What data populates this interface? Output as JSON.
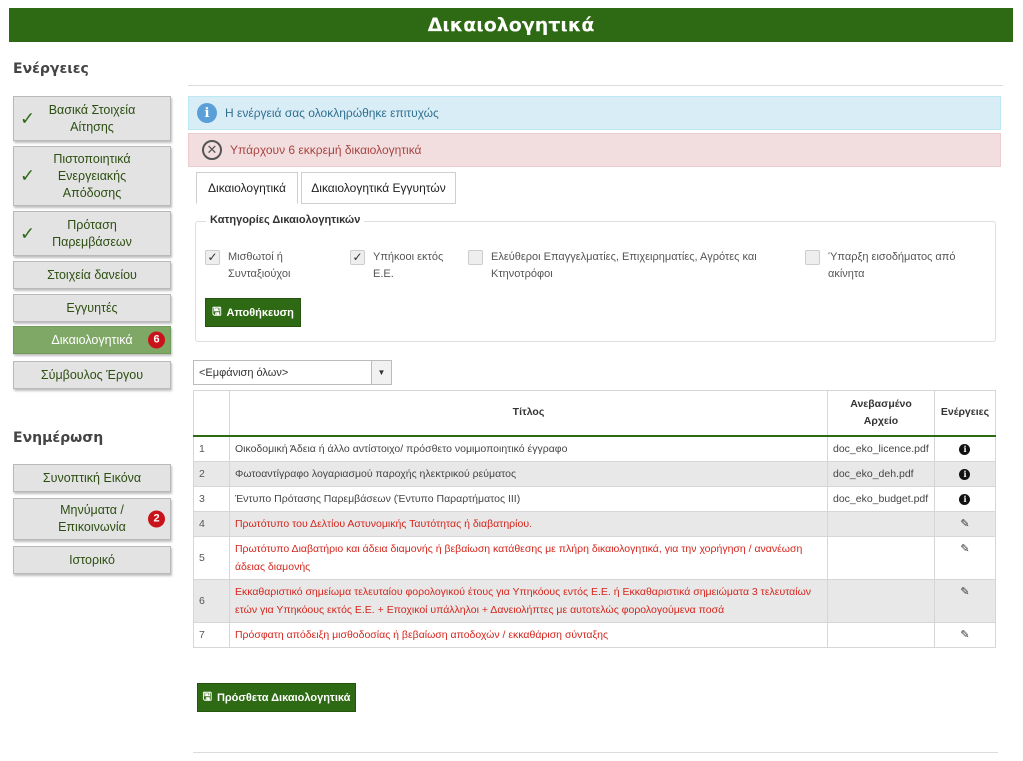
{
  "header": {
    "title": "Δικαιολογητικά"
  },
  "sidebar": {
    "actions_title": "Ενέργειες",
    "actions": [
      {
        "label": "Βασικά Στοιχεία Αίτησης",
        "checked": true
      },
      {
        "label": "Πιστοποιητικά Ενεργειακής Απόδοσης",
        "checked": true
      },
      {
        "label": "Πρόταση Παρεμβάσεων",
        "checked": true
      },
      {
        "label": "Στοιχεία δανείου"
      },
      {
        "label": "Εγγυητές"
      },
      {
        "label": "Δικαιολογητικά",
        "badge": "6",
        "active": true
      },
      {
        "label": "Σύμβουλος Έργου"
      }
    ],
    "check_glyph": "✓",
    "info_title": "Ενημέρωση",
    "info": [
      {
        "label": "Συνοπτική Εικόνα"
      },
      {
        "label": "Μηνύματα / Επικοινωνία",
        "badge": "2"
      },
      {
        "label": "Ιστορικό"
      }
    ]
  },
  "alerts": {
    "info": "Η ενέργειά σας ολοκληρώθηκε επιτυχώς",
    "danger": "Υπάρχουν 6 εκκρεμή δικαιολογητικά"
  },
  "tabs": [
    {
      "label": "Δικαιολογητικά",
      "active": true
    },
    {
      "label": "Δικαιολογητικά Εγγυητών"
    }
  ],
  "categories": {
    "legend": "Κατηγορίες Δικαιολογητικών",
    "items": [
      {
        "label": "Μισθωτοί ή Συνταξιούχοι",
        "checked": true
      },
      {
        "label": "Υπήκοοι εκτός Ε.Ε.",
        "checked": true
      },
      {
        "label": "Ελεύθεροι Επαγγελματίες, Επιχειρηματίες, Αγρότες και Κτηνοτρόφοι",
        "checked": false
      },
      {
        "label": "Ύπαρξη εισοδήματος από ακίνητα",
        "checked": false
      }
    ],
    "save_label": "Αποθήκευση"
  },
  "filter": {
    "selected": "<Εμφάνιση όλων>"
  },
  "table": {
    "headers": {
      "num": "",
      "title": "Τίτλος",
      "file": "Ανεβασμένο Αρχείο",
      "actions": "Ενέργειες"
    },
    "rows": [
      {
        "num": "1",
        "title": "Οικοδομική Άδεια ή άλλο αντίστοιχο/ πρόσθετο νομιμοποιητικό έγγραφο",
        "file": "doc_eko_licence.pdf",
        "action_icon": "info",
        "pending": false
      },
      {
        "num": "2",
        "title": "Φωτοαντίγραφο λογαριασμού παροχής ηλεκτρικού ρεύματος",
        "file": "doc_eko_deh.pdf",
        "action_icon": "info",
        "pending": false
      },
      {
        "num": "3",
        "title": "Έντυπο Πρότασης Παρεμβάσεων (Έντυπο Παραρτήματος ΙΙΙ)",
        "file": "doc_eko_budget.pdf",
        "action_icon": "info",
        "pending": false
      },
      {
        "num": "4",
        "title": "Πρωτότυπο του Δελτίου Αστυνομικής Ταυτότητας ή διαβατηρίου.",
        "file": "",
        "action_icon": "pencil",
        "pending": true
      },
      {
        "num": "5",
        "title": "Πρωτότυπο Διαβατήριο και άδεια διαμονής ή βεβαίωση κατάθεσης με πλήρη δικαιολογητικά, για την χορήγηση / ανανέωση άδειας διαμονής",
        "file": "",
        "action_icon": "pencil",
        "pending": true
      },
      {
        "num": "6",
        "title": "Εκκαθαριστικό σημείωμα τελευταίου φορολογικού έτους για Υπηκόους εντός Ε.Ε. ή Εκκαθαριστικά σημειώματα 3 τελευταίων ετών για Υπηκόους εκτός Ε.Ε. + Εποχικοί υπάλληλοι + Δανειολήπτες με αυτοτελώς φορολογούμενα ποσά",
        "file": "",
        "action_icon": "pencil",
        "pending": true
      },
      {
        "num": "7",
        "title": "Πρόσφατη απόδειξη μισθοδοσίας ή βεβαίωση αποδοχών / εκκαθάριση σύνταξης",
        "file": "",
        "action_icon": "pencil",
        "pending": true
      }
    ]
  },
  "extra_button": {
    "label": "Πρόσθετα Δικαιολογητικά"
  },
  "colors": {
    "brand": "#2e6a13",
    "pending_text": "#d5251c",
    "badge": "#c9131a"
  }
}
